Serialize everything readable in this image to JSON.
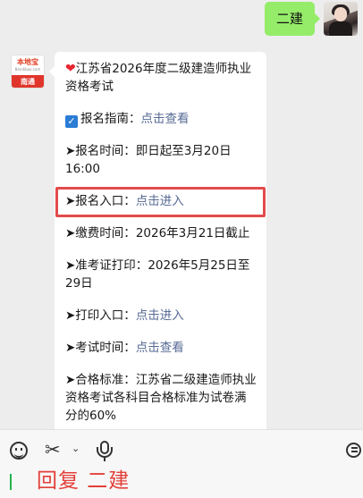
{
  "outgoing": {
    "text": "二建"
  },
  "incoming": {
    "avatar": {
      "brand": "本地宝",
      "url": "Bendibao.com",
      "city": "南通"
    },
    "title": "江苏省2026年度二级建造师执业资格考试",
    "guide": {
      "label": "报名指南：",
      "link": "点击查看"
    },
    "items": [
      {
        "label": "➤报名时间：",
        "value": "即日起至3月20日16:00"
      },
      {
        "label": "➤报名入口：",
        "link": "点击进入"
      },
      {
        "label": "➤缴费时间：",
        "value": "2026年3月21日截止"
      },
      {
        "label": "➤准考证打印：",
        "value": "2026年5月25日至29日"
      },
      {
        "label": "➤打印入口：",
        "link": "点击进入"
      },
      {
        "label": "➤考试时间：",
        "link": "点击查看"
      },
      {
        "label": "➤合格标准：",
        "value": "江苏省二级建造师执业资格考试各科目合格标准为试卷满分的60%"
      }
    ]
  },
  "composer": {
    "annotation": "回复 二建"
  },
  "colors": {
    "chat_bg": "#ededed",
    "outgoing_bubble": "#95ec69",
    "link": "#576b95",
    "highlight": "#e34b4b",
    "annotation": "#e3403a"
  },
  "icons": [
    "emoji-icon",
    "scissors-icon",
    "chevron-down-icon",
    "microphone-icon",
    "chat-bubble-icon",
    "heart-icon",
    "checkbox-icon"
  ]
}
